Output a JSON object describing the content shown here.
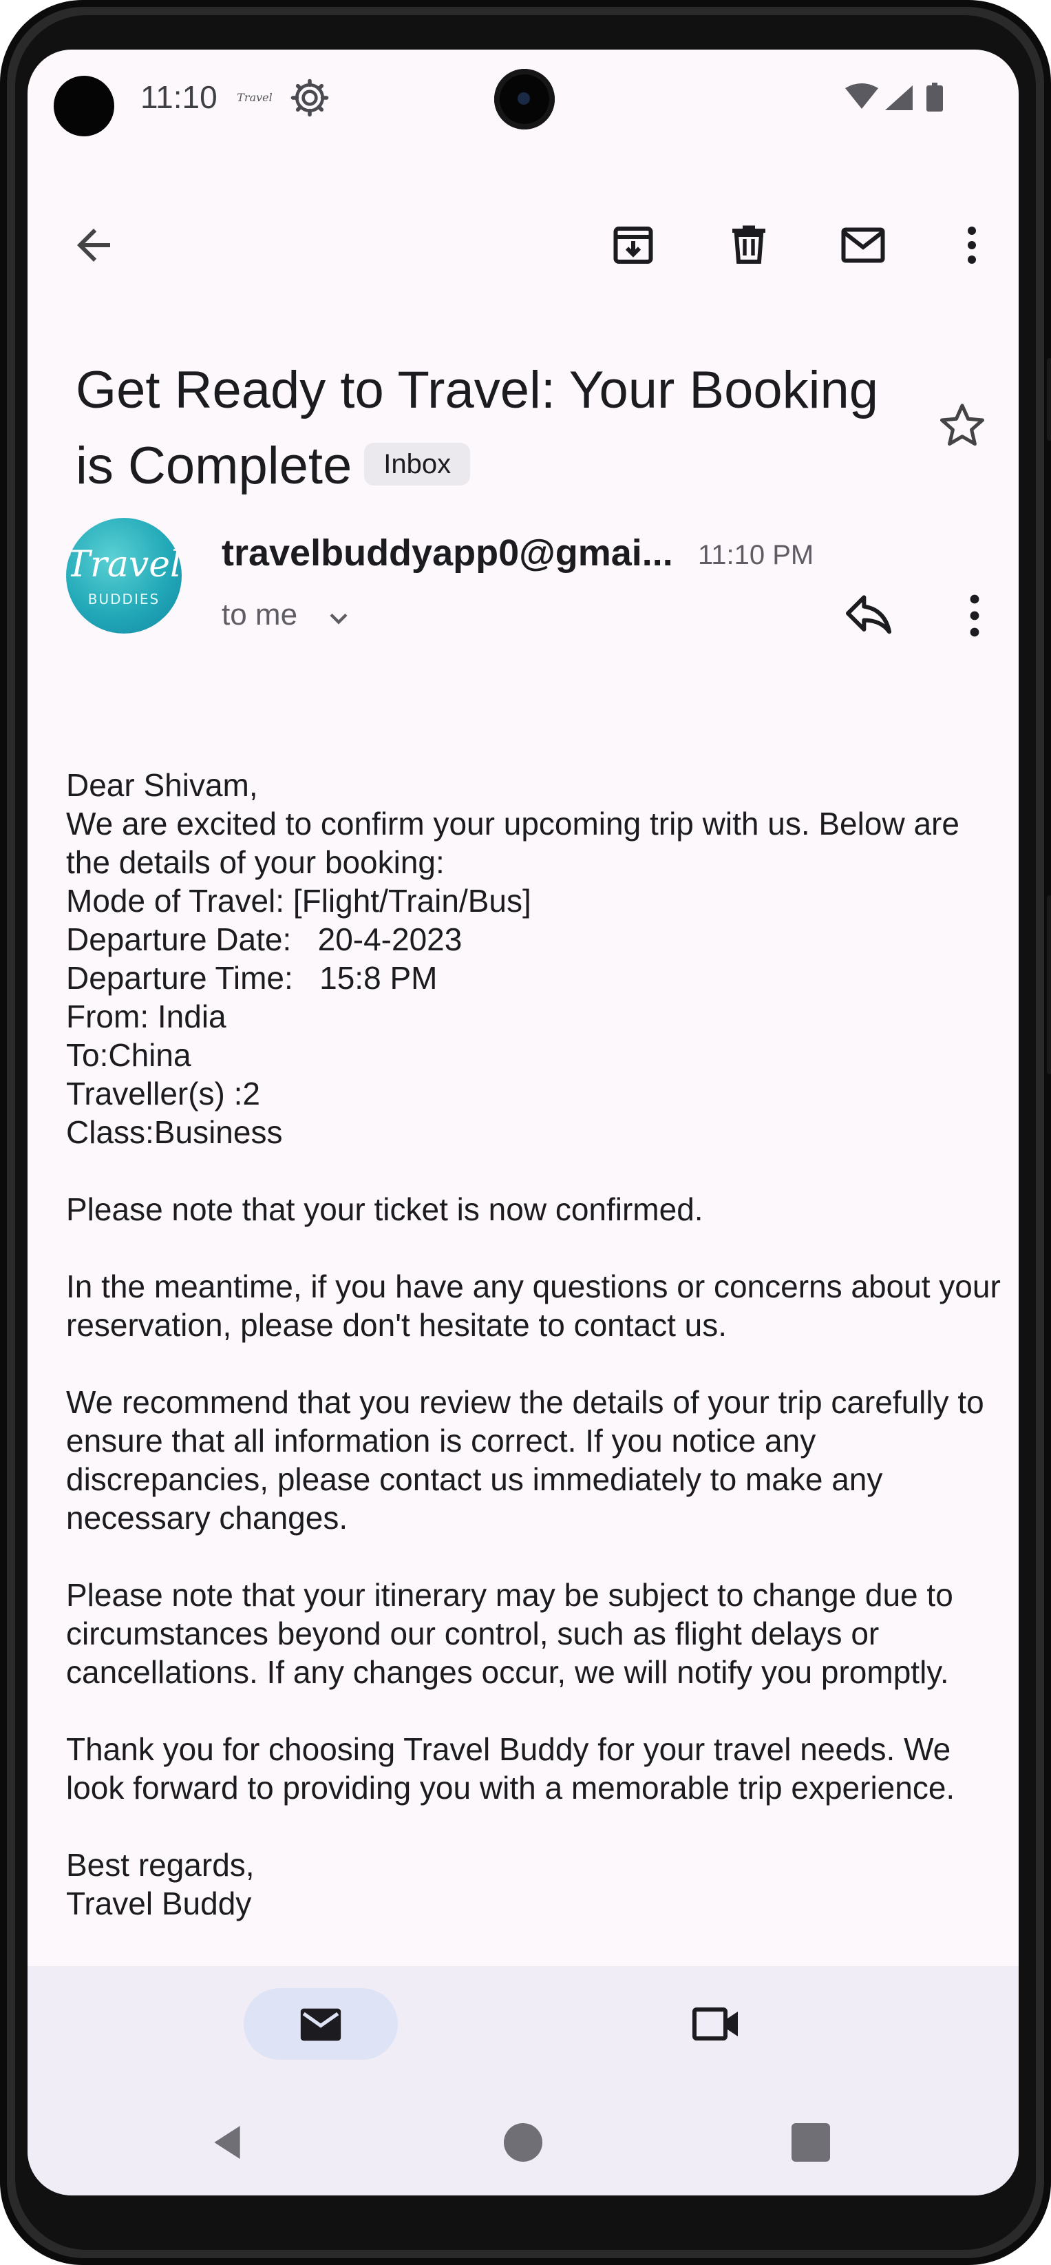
{
  "status_bar": {
    "time": "11:10",
    "app_icon": "travel-logo-icon",
    "icons": [
      "gear-icon",
      "wifi-icon",
      "signal-icon",
      "battery-icon"
    ]
  },
  "app_bar": {
    "icons": [
      "back-arrow-icon",
      "archive-icon",
      "delete-icon",
      "mark-unread-icon",
      "more-vert-icon"
    ]
  },
  "email": {
    "subject": "Get Ready to Travel: Your Booking is Complete",
    "label": "Inbox",
    "sender": "travelbuddyapp0@gmai...",
    "time": "11:10 PM",
    "recipient": "to me",
    "avatar": {
      "line1": "Travel",
      "line2": "BUDDIES"
    },
    "body": [
      "Dear Shivam,",
      "We are excited to confirm your upcoming trip with us. Below are the details of your booking:",
      "Mode of Travel: [Flight/Train/Bus]",
      "Departure Date:   20-4-2023",
      "Departure Time:   15:8 PM",
      "From: India",
      "To:China",
      "Traveller(s) :2",
      "Class:Business",
      "",
      "Please note that your ticket is now confirmed.",
      "",
      "In the meantime, if you have any questions or concerns about your reservation, please don't hesitate to contact us.",
      "",
      "We recommend that you review the details of your trip carefully to ensure that all information is correct. If you notice any discrepancies, please contact us immediately to make any necessary changes.",
      "",
      "Please note that your itinerary may be subject to change due to circumstances beyond our control, such as flight delays or cancellations. If any changes occur, we will notify you promptly.",
      "",
      "Thank you for choosing Travel Buddy for your travel needs. We look forward to providing you with a memorable trip experience.",
      "",
      "Best regards,",
      "Travel Buddy"
    ]
  },
  "bottom_nav": {
    "items": [
      {
        "icon": "mail-icon",
        "selected": true
      },
      {
        "icon": "video-icon",
        "selected": false
      }
    ]
  },
  "colors": {
    "background": "#fcf8fc",
    "text": "#1c1b1f",
    "nav_background": "#f0edf6",
    "nav_pill": "#dfe3f6",
    "avatar": "#22a9b8"
  }
}
